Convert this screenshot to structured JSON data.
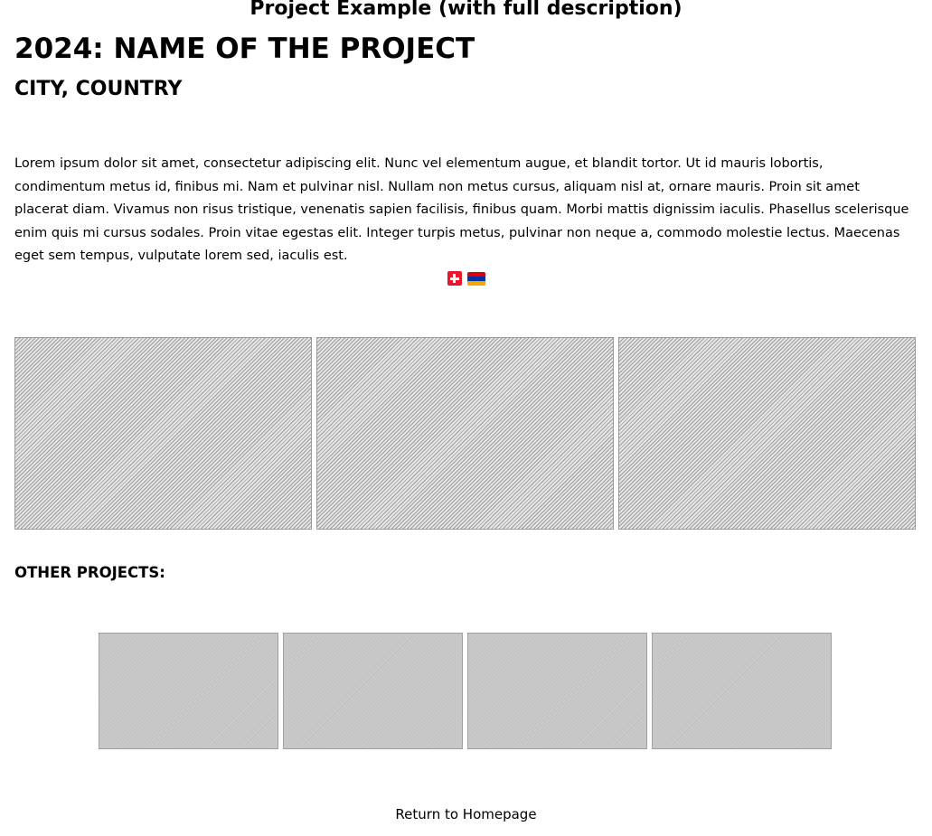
{
  "page": {
    "title": "Project Example (with full description)"
  },
  "project": {
    "heading": "2024: NAME OF THE PROJECT",
    "location": "CITY, COUNTRY",
    "description": "Lorem ipsum dolor sit amet, consectetur adipiscing elit. Nunc vel elementum augue, et blandit tortor. Ut id mauris lobortis, condimentum metus id, finibus mi. Nam et pulvinar nisl. Nullam non metus cursus, aliquam nisl at, ornare mauris. Proin sit amet placerat diam. Vivamus non risus tristique, venenatis sapien facilisis, finibus quam. Morbi mattis dignissim iaculis. Phasellus scelerisque enim quis mi cursus sodales. Proin vitae egestas elit. Integer turpis metus, pulvinar non neque a, commodo molestie lectus. Maecenas eget sem tempus, vulputate lorem sed, iaculis est.",
    "flags": [
      {
        "icon": "switzerland-flag-icon",
        "colors": [
          "#e8172b",
          "#ffffff"
        ]
      },
      {
        "icon": "armenia-flag-icon",
        "colors": [
          "#d90012",
          "#0033a0",
          "#f2a800"
        ]
      }
    ],
    "gallery_image_count": 3
  },
  "other_projects": {
    "heading": "OTHER PROJECTS:",
    "thumbnail_count": 4
  },
  "footer": {
    "return_link": "Return to Homepage"
  }
}
